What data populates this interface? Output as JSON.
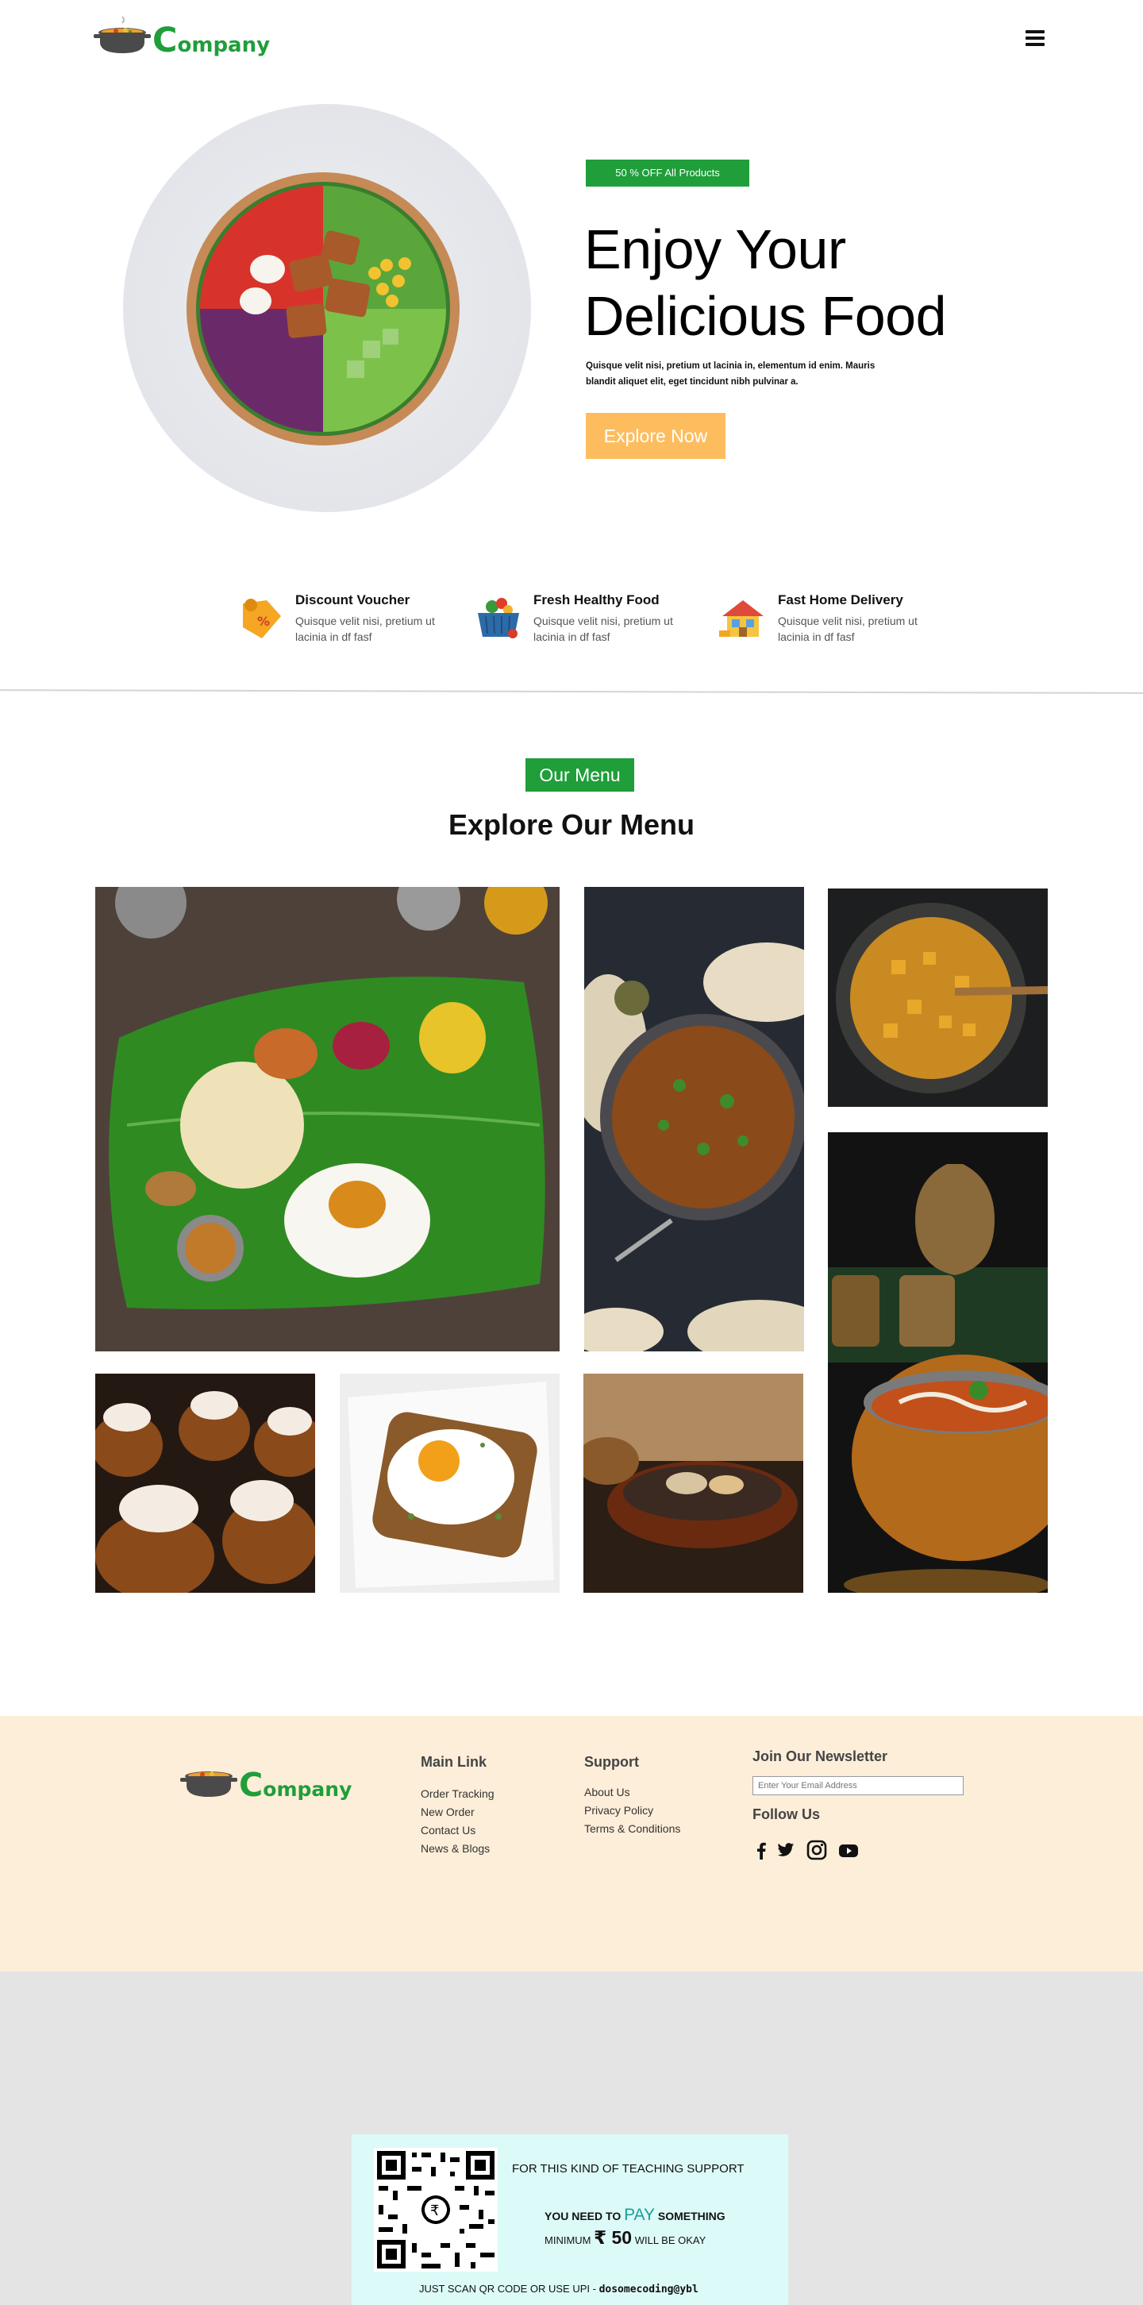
{
  "brand": {
    "logo_text": "Company",
    "logo_initial": "C",
    "logo_rest": "ompany",
    "color": "#1f9e3a"
  },
  "header": {
    "menu_icon": "hamburger-menu-icon"
  },
  "hero": {
    "badge": "50 % OFF  All Products",
    "title_line1": "Enjoy Your",
    "title_line2": "Delicious Food",
    "description": "Quisque velit nisi, pretium ut lacinia in, elementum id enim. Mauris blandit aliquet elit, eget tincidunt nibh pulvinar a.",
    "cta": "Explore Now",
    "cta_color": "#fdbd5f"
  },
  "features": [
    {
      "icon": "discount-tag-icon",
      "title": "Discount Voucher",
      "desc": "Quisque velit nisi, pretium ut lacinia in df fasf"
    },
    {
      "icon": "grocery-basket-icon",
      "title": "Fresh Healthy Food",
      "desc": "Quisque velit nisi, pretium ut lacinia in df fasf"
    },
    {
      "icon": "delivery-house-icon",
      "title": "Fast Home Delivery",
      "desc": "Quisque velit nisi, pretium ut lacinia in df fasf"
    }
  ],
  "menu": {
    "badge": "Our Menu",
    "title": "Explore Our Menu"
  },
  "footer": {
    "main_link_title": "Main Link",
    "main_links": [
      "Order Tracking",
      "New Order",
      "Contact Us",
      "News & Blogs"
    ],
    "support_title": "Support",
    "support_links": [
      "About Us",
      "Privacy Policy",
      "Terms & Conditions"
    ],
    "newsletter_title": "Join Our Newsletter",
    "newsletter_placeholder": "Enter Your Email Address",
    "follow_title": "Follow Us",
    "socials": [
      "facebook-icon",
      "twitter-icon",
      "instagram-icon",
      "youtube-icon"
    ],
    "background": "#fdeed9"
  },
  "support": {
    "line1": "FOR THIS KIND OF TEACHING SUPPORT",
    "line2_pre": "YOU NEED TO ",
    "line2_pay": "PAY",
    "line2_post": " SOMETHING",
    "line3_pre": "MINIMUM ",
    "line3_amount": "₹ 50",
    "line3_post": " WILL BE OKAY",
    "line4_pre": "JUST SCAN QR CODE OR USE UPI - ",
    "line4_upi": "dosomecoding@ybl"
  }
}
